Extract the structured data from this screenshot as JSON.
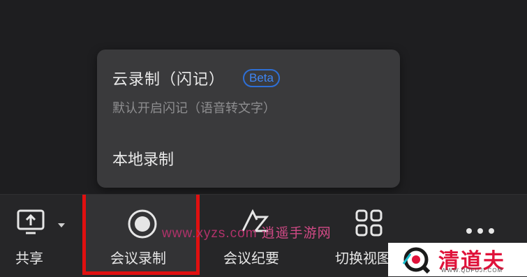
{
  "popup": {
    "cloud_record_title": "云录制（闪记）",
    "beta_badge": "Beta",
    "cloud_record_subtitle": "默认开启闪记（语音转文字）",
    "local_record": "本地录制"
  },
  "toolbar": {
    "share_label": "共享",
    "record_label": "会议录制",
    "summary_label": "会议纪要",
    "switch_view_label": "切换视图",
    "more_icon": "more-icon"
  },
  "watermark": {
    "url": "www.xyzs.com",
    "text": "逍遥手游网"
  },
  "brand": {
    "name": "清道夫",
    "url": "WWW.QDFUJI.COM"
  },
  "colors": {
    "highlight": "#e01010",
    "beta": "#3f86f5",
    "brand": "#e0123a"
  }
}
